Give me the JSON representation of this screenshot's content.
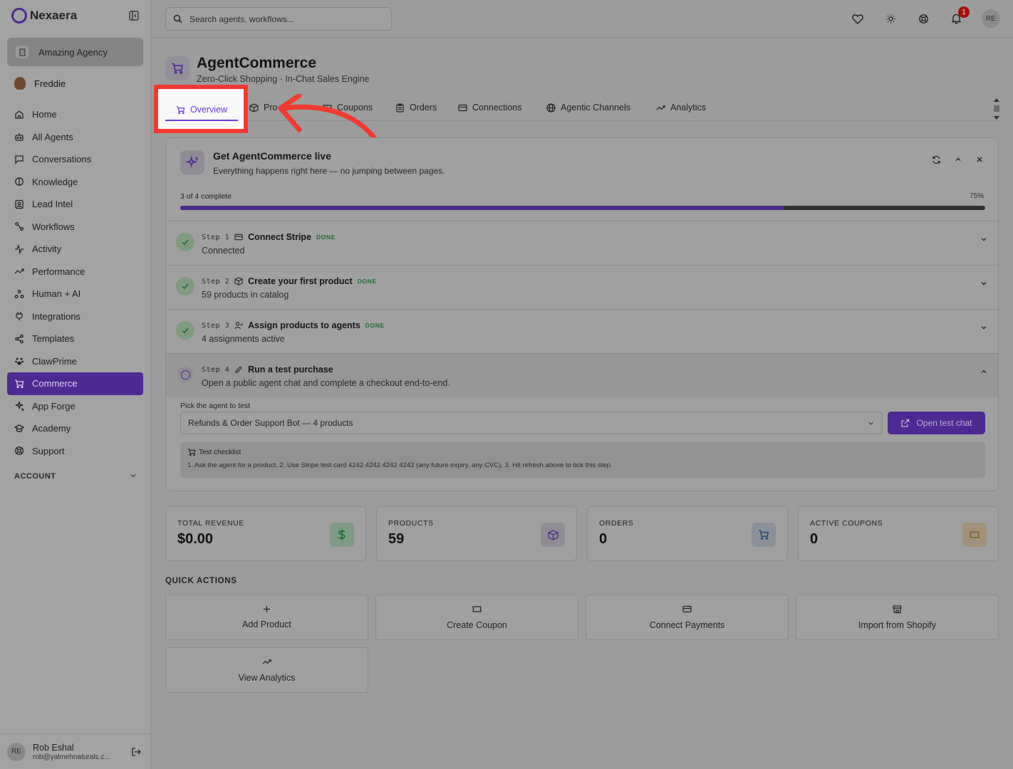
{
  "app": {
    "brand": "Nexaera"
  },
  "sidebar": {
    "org": "Amazing Agency",
    "user": "Freddie",
    "items": [
      {
        "label": "Home",
        "icon": "home-icon"
      },
      {
        "label": "All Agents",
        "icon": "bot-icon"
      },
      {
        "label": "Conversations",
        "icon": "message-icon"
      },
      {
        "label": "Knowledge",
        "icon": "brain-icon"
      },
      {
        "label": "Lead Intel",
        "icon": "contact-icon"
      },
      {
        "label": "Workflows",
        "icon": "workflow-icon"
      },
      {
        "label": "Activity",
        "icon": "activity-icon"
      },
      {
        "label": "Performance",
        "icon": "trend-icon"
      },
      {
        "label": "Human + AI",
        "icon": "people-icon"
      },
      {
        "label": "Integrations",
        "icon": "plug-icon"
      },
      {
        "label": "Templates",
        "icon": "share-icon"
      },
      {
        "label": "ClawPrime",
        "icon": "paw-icon"
      },
      {
        "label": "Commerce",
        "icon": "cart-icon"
      },
      {
        "label": "App Forge",
        "icon": "sparkles-icon"
      },
      {
        "label": "Academy",
        "icon": "graduation-cap-icon"
      },
      {
        "label": "Support",
        "icon": "lifebuoy-icon"
      }
    ],
    "account_label": "ACCOUNT",
    "profile": {
      "initials": "RE",
      "name": "Rob Eshal",
      "email": "rob@yalmehnaturals.c..."
    }
  },
  "topbar": {
    "search_placeholder": "Search agents, workflows...",
    "notification_count": "1",
    "avatar_initials": "RE"
  },
  "page": {
    "title": "AgentCommerce",
    "subtitle": "Zero-Click Shopping · In-Chat Sales Engine"
  },
  "tabs": [
    "Overview",
    "Pro",
    "Coupons",
    "Orders",
    "Connections",
    "Agentic Channels",
    "Analytics"
  ],
  "setup": {
    "title": "Get AgentCommerce live",
    "subtitle": "Everything happens right here — no jumping between pages.",
    "progress_label": "3 of 4 complete",
    "progress_pct_label": "75%",
    "progress": 0.75,
    "steps": [
      {
        "num": "Step 1",
        "title": "Connect Stripe",
        "status": "DONE",
        "desc": "Connected"
      },
      {
        "num": "Step 2",
        "title": "Create your first product",
        "status": "DONE",
        "desc": "59 products in catalog"
      },
      {
        "num": "Step 3",
        "title": "Assign products to agents",
        "status": "DONE",
        "desc": "4 assignments active"
      },
      {
        "num": "Step 4",
        "title": "Run a test purchase",
        "status": "",
        "desc": "Open a public agent chat and complete a checkout end-to-end."
      }
    ],
    "agent_label": "Pick the agent to test",
    "agent_value": "Refunds & Order Support Bot — 4 products",
    "test_button": "Open test chat",
    "checklist_title": "Test checklist",
    "checklist_text": "1. Ask the agent for a product. 2. Use Stripe test card 4242  4242  4242  4242 (any future expiry, any CVC). 3. Hit refresh above to tick this step."
  },
  "stats": [
    {
      "label": "TOTAL REVENUE",
      "value": "$0.00",
      "icon": "dollar-icon",
      "color": "#7f9a84"
    },
    {
      "label": "PRODUCTS",
      "value": "59",
      "icon": "box-icon",
      "color": "#8f8c96"
    },
    {
      "label": "ORDERS",
      "value": "0",
      "icon": "cart-icon",
      "color": "#8a8f98"
    },
    {
      "label": "ACTIVE COUPONS",
      "value": "0",
      "icon": "ticket-icon",
      "color": "#a2917a"
    }
  ],
  "quick_actions": {
    "title": "QUICK ACTIONS",
    "items": [
      {
        "label": "Add Product",
        "icon": "plus-icon"
      },
      {
        "label": "Create Coupon",
        "icon": "ticket-icon"
      },
      {
        "label": "Connect Payments",
        "icon": "card-icon"
      },
      {
        "label": "Import from Shopify",
        "icon": "store-icon"
      },
      {
        "label": "View Analytics",
        "icon": "trend-icon"
      }
    ]
  },
  "colors": {
    "accent": "#4d2a91",
    "highlight": "#f33a30",
    "success": "#1f6b2f"
  }
}
